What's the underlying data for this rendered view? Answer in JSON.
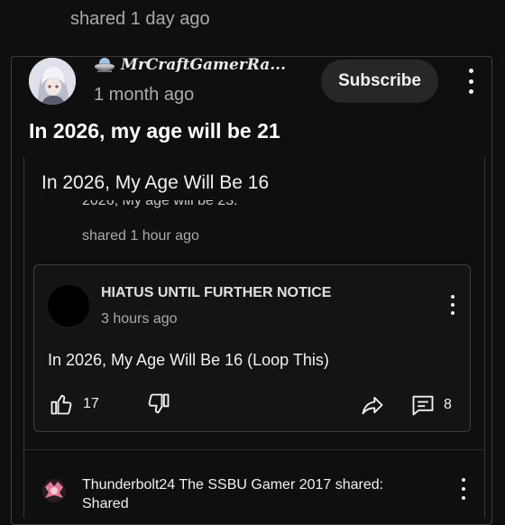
{
  "top_post": {
    "shared_time": "shared 1 day ago"
  },
  "post": {
    "channel_name": "MrCraftGamerRa...",
    "time": "1 month ago",
    "subscribe_label": "Subscribe",
    "title": "In 2026, my age will be 21"
  },
  "embed": {
    "title": "In 2026, My Age Will Be 16",
    "clipped_text": "2026, My age will be 23.",
    "shared_time": "shared 1 hour ago",
    "inner": {
      "channel_name": "HIATUS UNTIL FURTHER NOTICE",
      "time": "3 hours ago",
      "text": "In 2026, My Age Will Be 16 (Loop This)",
      "like_count": "17",
      "comment_count": "8"
    }
  },
  "next_post": {
    "line": "Thunderbolt24 The SSBU Gamer 2017 shared:",
    "sub": "Shared"
  },
  "icons": {
    "channel_badge": "ufo-icon",
    "more": "more-vertical-icon",
    "like": "thumbs-up-icon",
    "dislike": "thumbs-down-icon",
    "share": "share-icon",
    "comments": "comment-icon"
  },
  "colors": {
    "background": "#0f0f0f",
    "subscribe_bg": "#272727",
    "border": "#3f3f3f",
    "secondary_text": "#aaaaaa"
  }
}
